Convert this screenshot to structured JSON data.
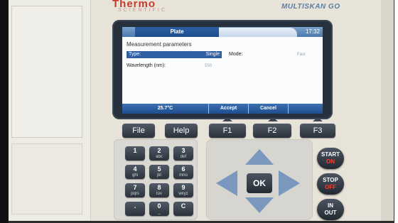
{
  "brand": {
    "name": "Thermo",
    "sub": "SCIENTIFIC",
    "model": "MULTISKAN GO"
  },
  "screen": {
    "title": "Plate",
    "clock": "17:32",
    "section": "Measurement parameters",
    "type_label": "Type:",
    "type_value": "Single",
    "mode_label": "Mode:",
    "mode_value": "Fast",
    "wavelength_label": "Wavelength (nm):",
    "wavelength_value": "550",
    "softkeys": {
      "temp": "25.7°C",
      "accept": "Accept",
      "cancel": "Cancel",
      "blank": ""
    }
  },
  "keys": {
    "file": "File",
    "help": "Help",
    "f1": "F1",
    "f2": "F2",
    "f3": "F3",
    "digits": [
      {
        "num": "1",
        "sub": ""
      },
      {
        "num": "2",
        "sub": "abc"
      },
      {
        "num": "3",
        "sub": "def"
      },
      {
        "num": "4",
        "sub": "ghi"
      },
      {
        "num": "5",
        "sub": "jkl"
      },
      {
        "num": "6",
        "sub": "mno"
      },
      {
        "num": "7",
        "sub": "pqrs"
      },
      {
        "num": "8",
        "sub": "tuv"
      },
      {
        "num": "9",
        "sub": "wxyz"
      },
      {
        "num": ".",
        "sub": ""
      },
      {
        "num": "0",
        "sub": "_"
      },
      {
        "num": "C",
        "sub": ""
      }
    ],
    "ok": "OK",
    "start": "START",
    "start_state": "ON",
    "stop": "STOP",
    "stop_state": "OFF",
    "in": "IN",
    "out": "OUT"
  },
  "colors": {
    "accent": "#2f5ea3",
    "brand_red": "#c43a2b",
    "arrow": "#7a98be"
  }
}
